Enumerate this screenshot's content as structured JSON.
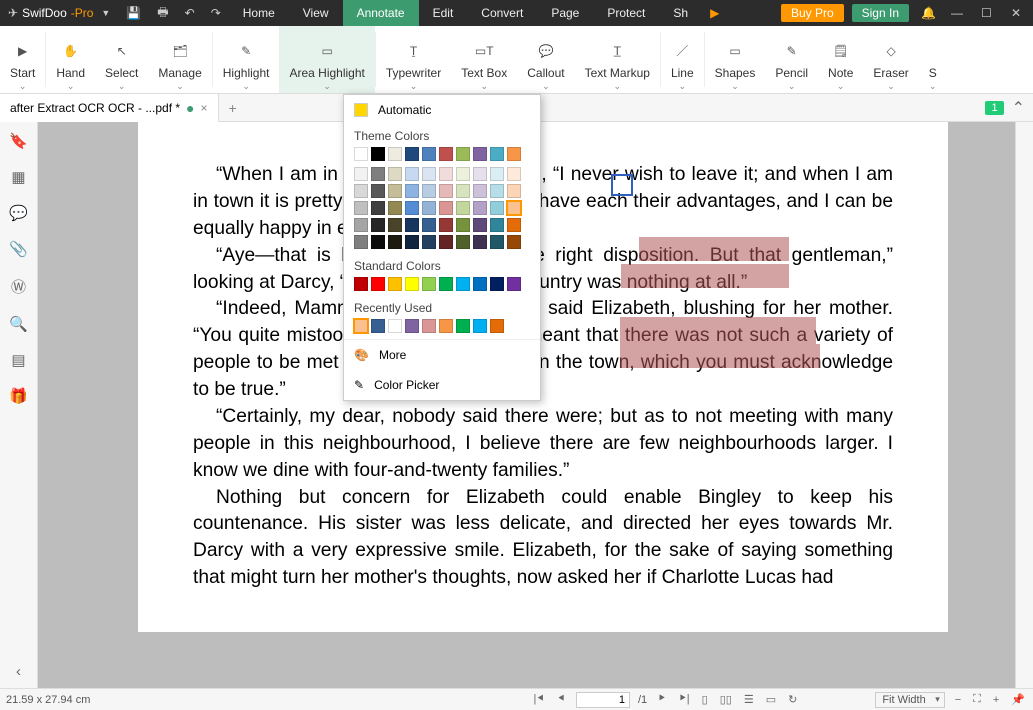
{
  "app": {
    "name": "SwifDoo",
    "edition": "-Pro"
  },
  "menu": [
    "Home",
    "View",
    "Annotate",
    "Edit",
    "Convert",
    "Page",
    "Protect",
    "Sh"
  ],
  "menu_active": 2,
  "titlebar": {
    "buy": "Buy Pro",
    "signin": "Sign In"
  },
  "ribbon": [
    {
      "label": "Start",
      "icon": "▶"
    },
    {
      "label": "Hand",
      "icon": "✋"
    },
    {
      "label": "Select",
      "icon": "↖"
    },
    {
      "label": "Manage",
      "icon": "🗂"
    },
    {
      "label": "Highlight",
      "icon": "✎"
    },
    {
      "label": "Area Highlight",
      "icon": "▭",
      "active": true
    },
    {
      "label": "Typewriter",
      "icon": "Ṯ"
    },
    {
      "label": "Text Box",
      "icon": "▭T"
    },
    {
      "label": "Callout",
      "icon": "💬"
    },
    {
      "label": "Text Markup",
      "icon": "T̲"
    },
    {
      "label": "Line",
      "icon": "／"
    },
    {
      "label": "Shapes",
      "icon": "▭"
    },
    {
      "label": "Pencil",
      "icon": "✎"
    },
    {
      "label": "Note",
      "icon": "🗒"
    },
    {
      "label": "Eraser",
      "icon": "◇"
    },
    {
      "label": "S",
      "icon": ""
    }
  ],
  "tab": {
    "title": "after Extract OCR OCR - ...pdf *"
  },
  "page_badge": "1",
  "color_popup": {
    "automatic": "Automatic",
    "theme_label": "Theme Colors",
    "standard_label": "Standard Colors",
    "recent_label": "Recently Used",
    "more": "More",
    "picker": "Color Picker",
    "theme_row1": [
      "#ffffff",
      "#000000",
      "#eeece1",
      "#1f497d",
      "#4f81bd",
      "#c0504d",
      "#9bbb59",
      "#8064a2",
      "#4bacc6",
      "#f79646"
    ],
    "theme_rows": [
      [
        "#f2f2f2",
        "#7f7f7f",
        "#ddd9c3",
        "#c6d9f0",
        "#dbe5f1",
        "#f2dcdb",
        "#ebf1dd",
        "#e5e0ec",
        "#dbeef3",
        "#fdeada"
      ],
      [
        "#d8d8d8",
        "#595959",
        "#c4bd97",
        "#8db3e2",
        "#b8cce4",
        "#e5b9b7",
        "#d7e3bc",
        "#ccc1d9",
        "#b7dde8",
        "#fbd5b5"
      ],
      [
        "#bfbfbf",
        "#3f3f3f",
        "#938953",
        "#548dd4",
        "#95b3d7",
        "#d99694",
        "#c3d69b",
        "#b2a2c7",
        "#92cddc",
        "#fac08f"
      ],
      [
        "#a5a5a5",
        "#262626",
        "#494429",
        "#17365d",
        "#366092",
        "#953734",
        "#76923c",
        "#5f497a",
        "#31859b",
        "#e36c09"
      ],
      [
        "#7f7f7f",
        "#0c0c0c",
        "#1d1b10",
        "#0f243e",
        "#244061",
        "#632423",
        "#4f6128",
        "#3f3151",
        "#205867",
        "#974806"
      ]
    ],
    "standard": [
      "#c00000",
      "#ff0000",
      "#ffc000",
      "#ffff00",
      "#92d050",
      "#00b050",
      "#00b0f0",
      "#0070c0",
      "#002060",
      "#7030a0"
    ],
    "recent": [
      "#fac08f",
      "#366092",
      "#ffffff",
      "#8064a2",
      "#d99694",
      "#f79646",
      "#00b050",
      "#00b0f0",
      "#e36c09"
    ],
    "selected": "#fac08f"
  },
  "document": {
    "p1": "“When I am in the country,” he replied, “I never wish to leave it; and when I am in town it is pretty much the same. They have each their advantages, and I can be equally happy in either.”",
    "p2": "“Aye—that is because you have the right disposition. But that gentleman,” looking at Darcy, “seemed to think the country was nothing at all.”",
    "p3": "“Indeed, Mamma, you are mistaken,” said Elizabeth, blushing for her mother. “You quite mistook Mr. Darcy. He only meant that there was not such a variety of people to be met with in the country as in the town, which you must acknowledge to be true.”",
    "p4": "“Certainly, my dear, nobody said there were; but as to not meeting with many people in this neighbourhood, I believe there are few neighbourhoods larger. I know we dine with four-and-twenty families.”",
    "p5": "Nothing but concern for Elizabeth could enable Bingley to keep his countenance. His sister was less delicate, and directed her eyes towards Mr. Darcy with a very expressive smile. Elizabeth, for the sake of saying something that might turn her mother's thoughts, now asked her if Charlotte Lucas had"
  },
  "status": {
    "dims": "21.59 x 27.94 cm",
    "page_current": "1",
    "page_sep": "/1",
    "zoom": "Fit Width"
  }
}
